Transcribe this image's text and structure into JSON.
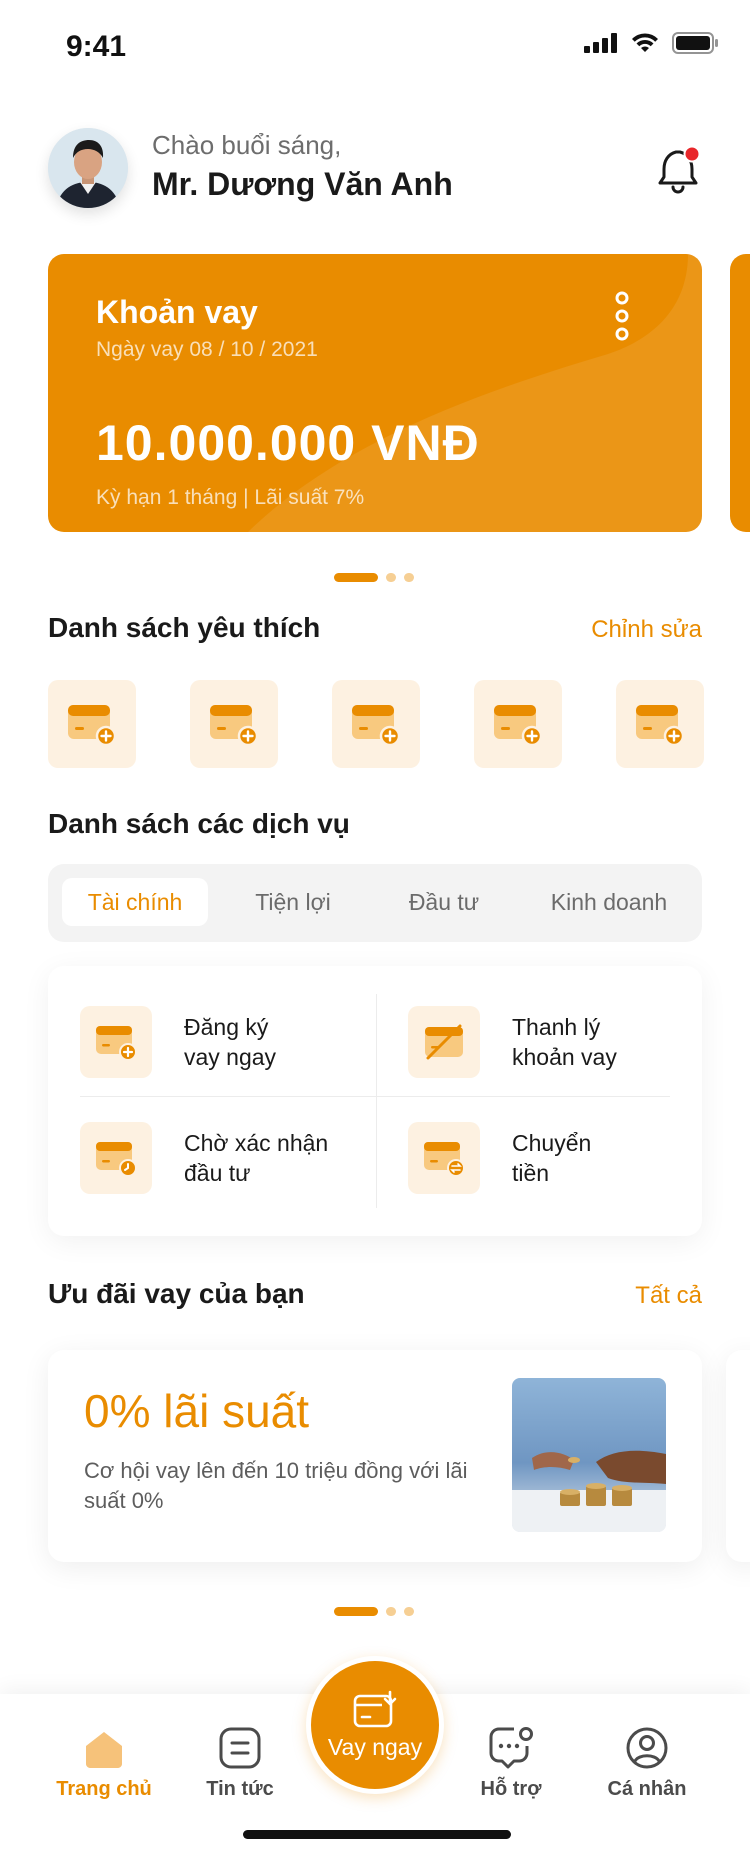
{
  "status_bar": {
    "time": "9:41"
  },
  "header": {
    "greeting": "Chào buổi sáng,",
    "user_name": "Mr. Dương Văn Anh"
  },
  "loan_card": {
    "title": "Khoản vay",
    "date": "Ngày vay 08 / 10 / 2021",
    "amount": "10.000.000 VNĐ",
    "terms": "Kỳ hạn 1 tháng  |  Lãi suất 7%"
  },
  "favorites": {
    "title": "Danh sách yêu thích",
    "edit_label": "Chỉnh sửa",
    "count": 5
  },
  "services": {
    "title": "Danh sách các dịch vụ",
    "tabs": [
      "Tài chính",
      "Tiện lợi",
      "Đầu tư",
      "Kinh doanh"
    ],
    "active_tab": "Tài chính",
    "items": [
      {
        "line1": "Đăng ký",
        "line2": "vay ngay",
        "icon": "card-add-icon"
      },
      {
        "line1": "Thanh lý",
        "line2": "khoản vay",
        "icon": "card-slash-icon"
      },
      {
        "line1": "Chờ xác nhận",
        "line2": "đầu tư",
        "icon": "card-clock-icon"
      },
      {
        "line1": "Chuyển",
        "line2": "tiền",
        "icon": "card-transfer-icon"
      }
    ]
  },
  "offers": {
    "title": "Ưu đãi vay của bạn",
    "all_label": "Tất cả",
    "headline": "0% lãi suất",
    "description": "Cơ hội vay lên đến 10 triệu đồng với lãi suất 0%"
  },
  "bottom_nav": {
    "home": "Trang chủ",
    "news": "Tin tức",
    "borrow": "Vay ngay",
    "support": "Hỗ trợ",
    "profile": "Cá nhân"
  },
  "colors": {
    "accent": "#e98c00",
    "accent_light": "#fdf1e1",
    "notification_dot": "#e8262a"
  }
}
